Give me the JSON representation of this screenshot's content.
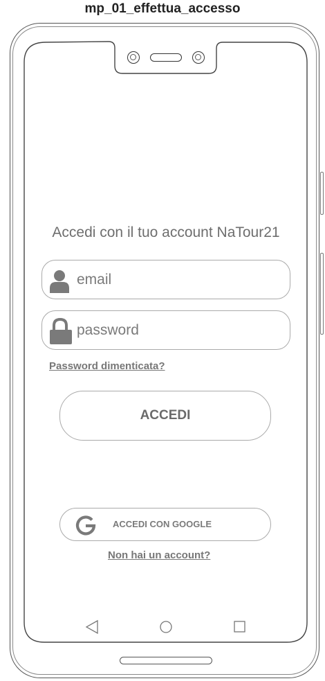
{
  "page_title": "mp_01_effettua_accesso",
  "login": {
    "heading": "Accedi con il tuo account NaTour21",
    "email_placeholder": "email",
    "password_placeholder": "password",
    "forgot_password": "Password dimenticata?",
    "submit_label": "ACCEDI",
    "google_label": "ACCEDI CON GOOGLE",
    "signup_link": "Non hai un account?"
  },
  "icons": {
    "email": "user-icon",
    "password": "lock-icon",
    "google": "google-icon",
    "nav_back": "triangle-back-icon",
    "nav_home": "circle-home-icon",
    "nav_recents": "square-recents-icon"
  },
  "colors": {
    "text_muted": "#6e6e6e",
    "icon_gray": "#7a7a7a",
    "border": "#aaaaaa"
  }
}
